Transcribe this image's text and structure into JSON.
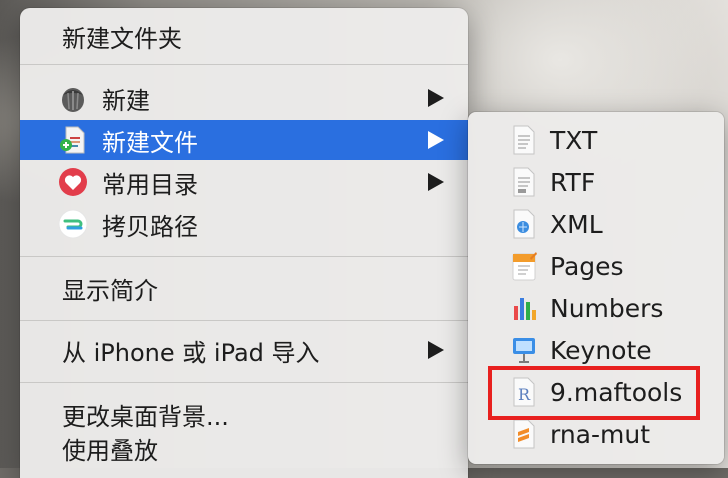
{
  "main_menu": {
    "top_item": "新建文件夹",
    "group1": [
      {
        "label": "新建",
        "icon": "acorn-icon",
        "has_submenu": true
      },
      {
        "label": "新建文件",
        "icon": "new-file-icon",
        "has_submenu": true,
        "selected": true
      },
      {
        "label": "常用目录",
        "icon": "heart-icon",
        "has_submenu": true
      },
      {
        "label": "拷贝路径",
        "icon": "copy-path-icon",
        "has_submenu": false
      }
    ],
    "get_info": "显示简介",
    "import_item": "从 iPhone 或 iPad 导入",
    "change_background": "更改桌面背景...",
    "use_stacks": "使用叠放"
  },
  "submenu": {
    "items": [
      {
        "label": "TXT",
        "icon": "txt-file-icon"
      },
      {
        "label": "RTF",
        "icon": "rtf-file-icon"
      },
      {
        "label": "XML",
        "icon": "xml-file-icon"
      },
      {
        "label": "Pages",
        "icon": "pages-app-icon"
      },
      {
        "label": "Numbers",
        "icon": "numbers-app-icon"
      },
      {
        "label": "Keynote",
        "icon": "keynote-app-icon"
      },
      {
        "label": "9.maftools",
        "icon": "r-file-icon",
        "highlighted": true
      },
      {
        "label": "rna-mut",
        "icon": "sublime-file-icon"
      }
    ]
  },
  "colors": {
    "selection": "#2a6fe0",
    "highlight_border": "#e8201f"
  }
}
